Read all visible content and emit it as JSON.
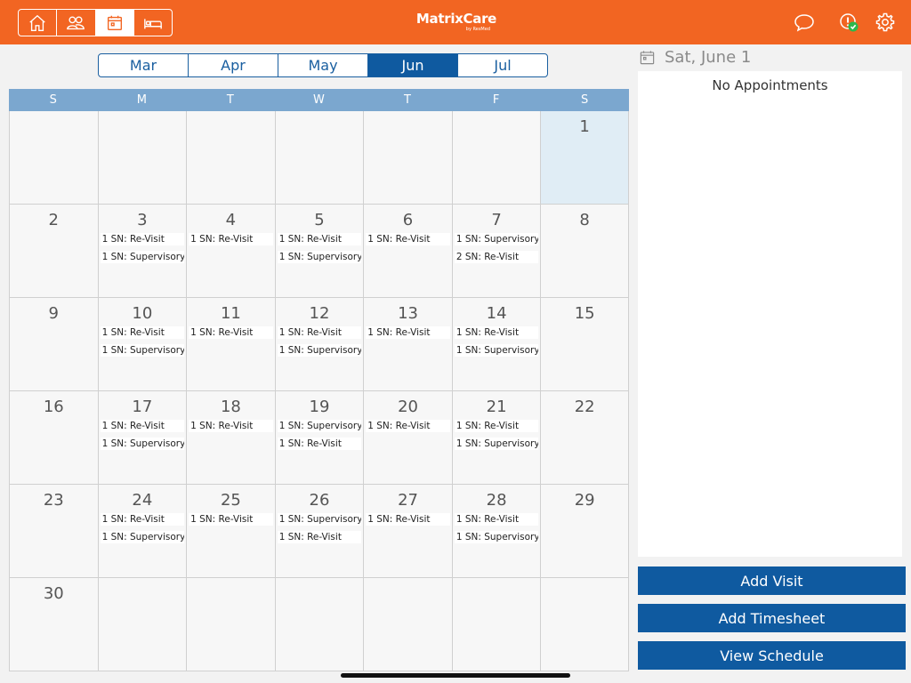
{
  "app": {
    "logo_text": "MatrixCare",
    "logo_sub": "by ResMed"
  },
  "colors": {
    "brand_orange": "#f26522",
    "primary_blue": "#0f5aa0",
    "header_blue": "#7ba7cf",
    "selected_day": "#e0edf5"
  },
  "top_nav": [
    {
      "name": "home",
      "icon": "home-icon",
      "active": false
    },
    {
      "name": "patients",
      "icon": "people-icon",
      "active": false
    },
    {
      "name": "calendar",
      "icon": "calendar-icon",
      "active": true
    },
    {
      "name": "bed",
      "icon": "bed-icon",
      "active": false
    }
  ],
  "top_right_icons": [
    "chat-bubble-icon",
    "alert-check-icon",
    "gear-icon"
  ],
  "month_tabs": [
    {
      "label": "Mar",
      "active": false
    },
    {
      "label": "Apr",
      "active": false
    },
    {
      "label": "May",
      "active": false
    },
    {
      "label": "Jun",
      "active": true
    },
    {
      "label": "Jul",
      "active": false
    }
  ],
  "calendar": {
    "day_headers": [
      "S",
      "M",
      "T",
      "W",
      "T",
      "F",
      "S"
    ],
    "weeks": [
      [
        {
          "day": "",
          "appts": []
        },
        {
          "day": "",
          "appts": []
        },
        {
          "day": "",
          "appts": []
        },
        {
          "day": "",
          "appts": []
        },
        {
          "day": "",
          "appts": []
        },
        {
          "day": "",
          "appts": []
        },
        {
          "day": "1",
          "appts": [],
          "selected": true
        }
      ],
      [
        {
          "day": "2",
          "appts": []
        },
        {
          "day": "3",
          "appts": [
            "1 SN: Re-Visit",
            "1 SN: Supervisory"
          ]
        },
        {
          "day": "4",
          "appts": [
            "1 SN: Re-Visit"
          ]
        },
        {
          "day": "5",
          "appts": [
            "1 SN: Re-Visit",
            "1 SN: Supervisory"
          ]
        },
        {
          "day": "6",
          "appts": [
            "1 SN: Re-Visit"
          ]
        },
        {
          "day": "7",
          "appts": [
            "1 SN: Supervisory",
            "2 SN: Re-Visit"
          ]
        },
        {
          "day": "8",
          "appts": []
        }
      ],
      [
        {
          "day": "9",
          "appts": []
        },
        {
          "day": "10",
          "appts": [
            "1 SN: Re-Visit",
            "1 SN: Supervisory"
          ]
        },
        {
          "day": "11",
          "appts": [
            "1 SN: Re-Visit"
          ]
        },
        {
          "day": "12",
          "appts": [
            "1 SN: Re-Visit",
            "1 SN: Supervisory"
          ]
        },
        {
          "day": "13",
          "appts": [
            "1 SN: Re-Visit"
          ]
        },
        {
          "day": "14",
          "appts": [
            "1 SN: Re-Visit",
            "1 SN: Supervisory"
          ]
        },
        {
          "day": "15",
          "appts": []
        }
      ],
      [
        {
          "day": "16",
          "appts": []
        },
        {
          "day": "17",
          "appts": [
            "1 SN: Re-Visit",
            "1 SN: Supervisory"
          ]
        },
        {
          "day": "18",
          "appts": [
            "1 SN: Re-Visit"
          ]
        },
        {
          "day": "19",
          "appts": [
            "1 SN: Supervisory",
            "1 SN: Re-Visit"
          ]
        },
        {
          "day": "20",
          "appts": [
            "1 SN: Re-Visit"
          ]
        },
        {
          "day": "21",
          "appts": [
            "1 SN: Re-Visit",
            "1 SN: Supervisory"
          ]
        },
        {
          "day": "22",
          "appts": []
        }
      ],
      [
        {
          "day": "23",
          "appts": []
        },
        {
          "day": "24",
          "appts": [
            "1 SN: Re-Visit",
            "1 SN: Supervisory"
          ]
        },
        {
          "day": "25",
          "appts": [
            "1 SN: Re-Visit"
          ]
        },
        {
          "day": "26",
          "appts": [
            "1 SN: Supervisory",
            "1 SN: Re-Visit"
          ]
        },
        {
          "day": "27",
          "appts": [
            "1 SN: Re-Visit"
          ]
        },
        {
          "day": "28",
          "appts": [
            "1 SN: Re-Visit",
            "1 SN: Supervisory"
          ]
        },
        {
          "day": "29",
          "appts": []
        }
      ],
      [
        {
          "day": "30",
          "appts": []
        },
        {
          "day": "",
          "appts": []
        },
        {
          "day": "",
          "appts": []
        },
        {
          "day": "",
          "appts": []
        },
        {
          "day": "",
          "appts": []
        },
        {
          "day": "",
          "appts": []
        },
        {
          "day": "",
          "appts": []
        }
      ]
    ]
  },
  "detail": {
    "date_label": "Sat, June 1",
    "empty_text": "No Appointments"
  },
  "actions": {
    "add_visit": "Add Visit",
    "add_timesheet": "Add Timesheet",
    "view_schedule": "View Schedule"
  }
}
